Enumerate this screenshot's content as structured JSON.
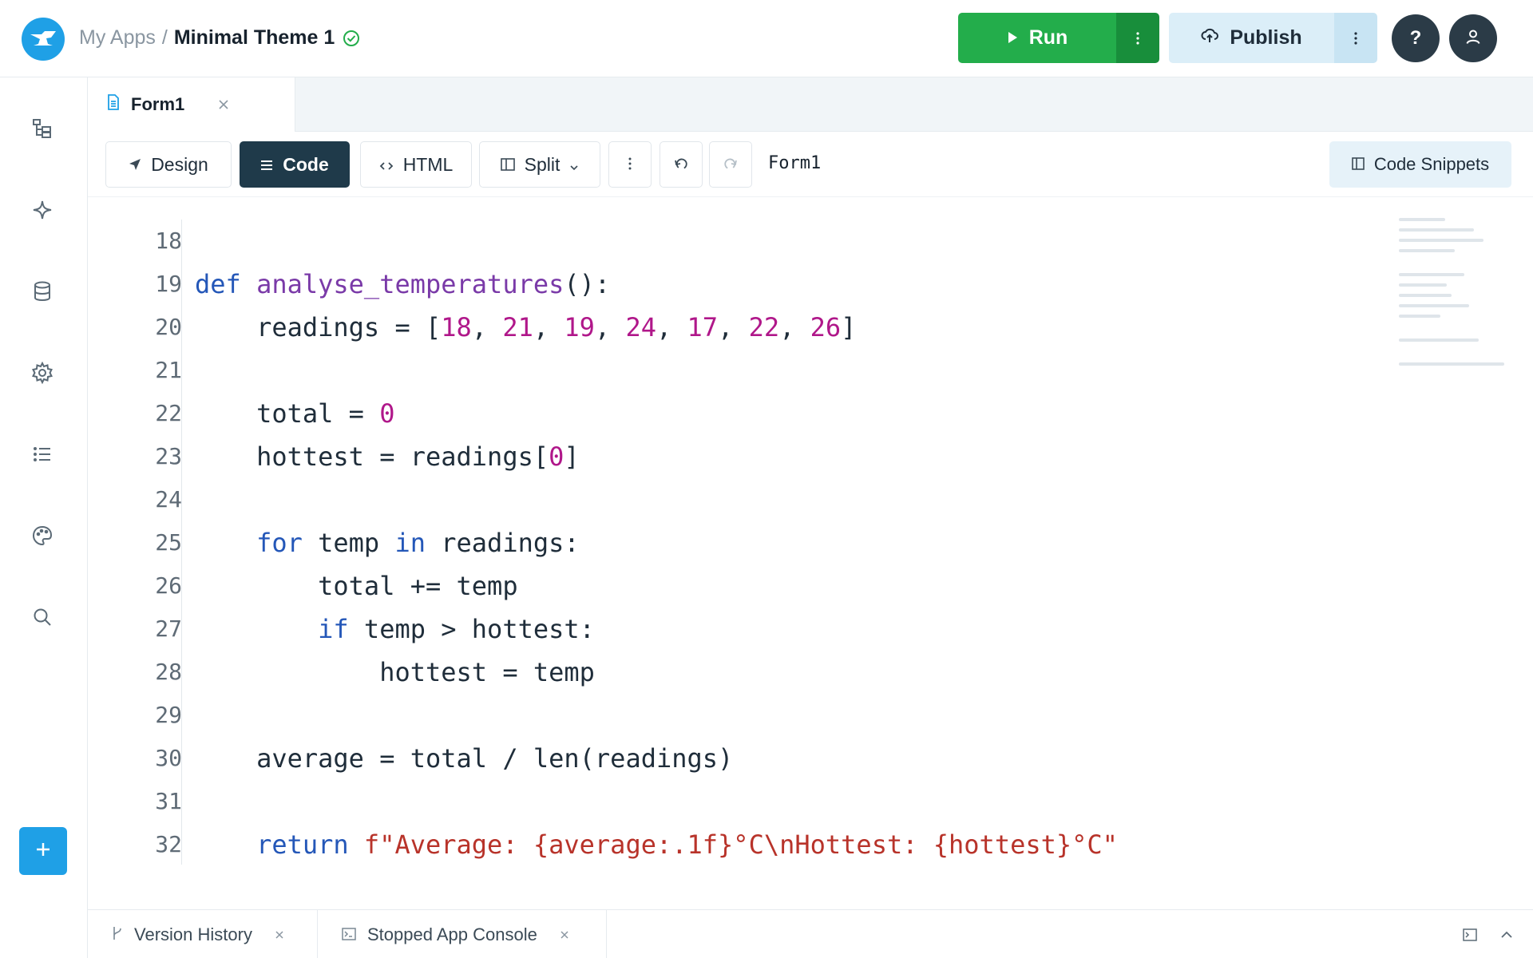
{
  "header": {
    "breadcrumb_root": "My Apps",
    "breadcrumb_sep": "/",
    "app_name": "Minimal Theme 1",
    "run_label": "Run",
    "publish_label": "Publish",
    "help_label": "?"
  },
  "sidebar": {
    "icons": [
      "app-tree-icon",
      "sparkle-icon",
      "database-icon",
      "settings-icon",
      "list-icon",
      "palette-icon",
      "search-icon"
    ],
    "add_icon": "plus-icon"
  },
  "tabs": [
    {
      "label": "Form1",
      "icon": "file-icon"
    }
  ],
  "toolbar": {
    "design_label": "Design",
    "code_label": "Code",
    "html_label": "HTML",
    "split_label": "Split",
    "current_form": "Form1",
    "snippets_label": "Code Snippets"
  },
  "editor": {
    "line_numbers": [
      "18",
      "19",
      "20",
      "21",
      "22",
      "23",
      "24",
      "25",
      "26",
      "27",
      "28",
      "29",
      "30",
      "31",
      "32"
    ],
    "lines": [
      "",
      "def analyse_temperatures():",
      "    readings = [18, 21, 19, 24, 17, 22, 26]",
      "",
      "    total = 0",
      "    hottest = readings[0]",
      "",
      "    for temp in readings:",
      "        total += temp",
      "        if temp > hottest:",
      "            hottest = temp",
      "",
      "    average = total / len(readings)",
      "",
      "    return f\"Average: {average:.1f}°C\\nHottest: {hottest}°C\""
    ]
  },
  "bottom_panel": {
    "tabs": [
      {
        "label": "Version History",
        "icon": "branch-icon"
      },
      {
        "label": "Stopped App Console",
        "icon": "terminal-icon"
      }
    ]
  },
  "colors": {
    "accent": "#1fa0e6",
    "run_green": "#23ad4b",
    "publish_bg": "#dbeef8",
    "dark": "#2b3b47",
    "keyword": "#2457b8",
    "function": "#7a3aa8",
    "number": "#b0178a",
    "string": "#b8332a"
  }
}
